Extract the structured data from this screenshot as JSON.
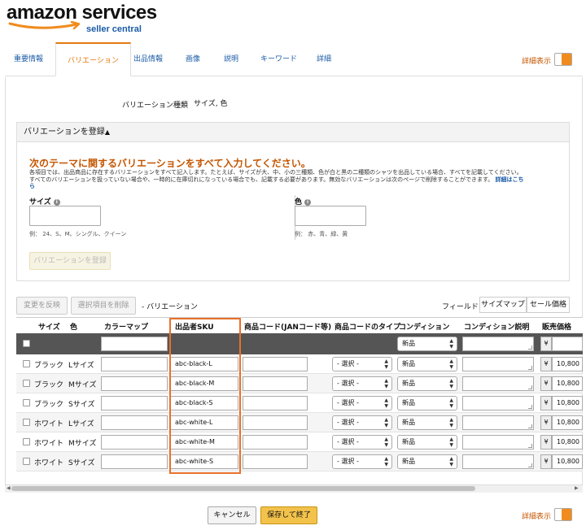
{
  "brand": {
    "name": "amazon services",
    "sub": "seller central"
  },
  "tabs": [
    {
      "label": "重要情報"
    },
    {
      "label": "バリエーション"
    },
    {
      "label": "出品情報"
    },
    {
      "label": "画像"
    },
    {
      "label": "説明"
    },
    {
      "label": "キーワード"
    },
    {
      "label": "詳細"
    }
  ],
  "detail_toggle": {
    "label": "詳細表示"
  },
  "theme": {
    "label": "バリエーション種類",
    "value": "サイズ, 色"
  },
  "register": {
    "header": "バリエーションを登録",
    "title": "次のテーマに関するバリエーションをすべて入力してください。",
    "desc_line1": "各項目では、出品商品に存在するバリエーションをすべて記入します。たとえば、サイズが大、中、小の三種類、色が白と黒の二種類のシャツを出品している場合、すべてを記載してください。",
    "desc_line2": "すべてのバリエーションを扱っていない場合や、一時的に在庫切れになっている場合でも、記載する必要があります。無効なバリエーションは次のページで削除することができます。",
    "desc_link": "詳細はこちら",
    "size_label": "サイズ",
    "size_example": "例： 24、S、M、シングル、クイーン",
    "color_label": "色",
    "color_example": "例： 赤、青、緑、黄",
    "submit_label": "バリエーションを登録"
  },
  "actions": {
    "apply_changes": "変更を反映",
    "delete_selected": "選択項目を削除",
    "variation_label": "- バリエーション",
    "fields_label": "フィールド:",
    "size_map_button": "サイズマップ",
    "sale_price_button": "セール価格"
  },
  "table": {
    "headers": {
      "size": "サイズ",
      "color": "色",
      "color_map": "カラーマップ",
      "sku": "出品者SKU",
      "product_code": "商品コード(JANコード等)",
      "code_type": "商品コードのタイプ",
      "condition": "コンディション",
      "condition_note": "コンディション説明",
      "price": "販売価格"
    },
    "bulk": {
      "condition": "新品",
      "currency": "¥"
    },
    "select_placeholder": "- 選択 -",
    "currency": "¥",
    "rows": [
      {
        "color": "ブラック",
        "size": "Lサイズ",
        "sku": "abc-black-L",
        "condition": "新品",
        "price": "10,800"
      },
      {
        "color": "ブラック",
        "size": "Mサイズ",
        "sku": "abc-black-M",
        "condition": "新品",
        "price": "10,800"
      },
      {
        "color": "ブラック",
        "size": "Sサイズ",
        "sku": "abc-black-S",
        "condition": "新品",
        "price": "10,800"
      },
      {
        "color": "ホワイト",
        "size": "Lサイズ",
        "sku": "abc-white-L",
        "condition": "新品",
        "price": "10,800"
      },
      {
        "color": "ホワイト",
        "size": "Mサイズ",
        "sku": "abc-white-M",
        "condition": "新品",
        "price": "10,800"
      },
      {
        "color": "ホワイト",
        "size": "Sサイズ",
        "sku": "abc-white-S",
        "condition": "新品",
        "price": "10,800"
      }
    ]
  },
  "footer": {
    "cancel": "キャンセル",
    "save_finish": "保存して終了"
  },
  "colors": {
    "accent_orange": "#e47911",
    "link_blue": "#1a5aa6",
    "save_yellow": "#f3c24b",
    "highlight": "#e8702a"
  }
}
